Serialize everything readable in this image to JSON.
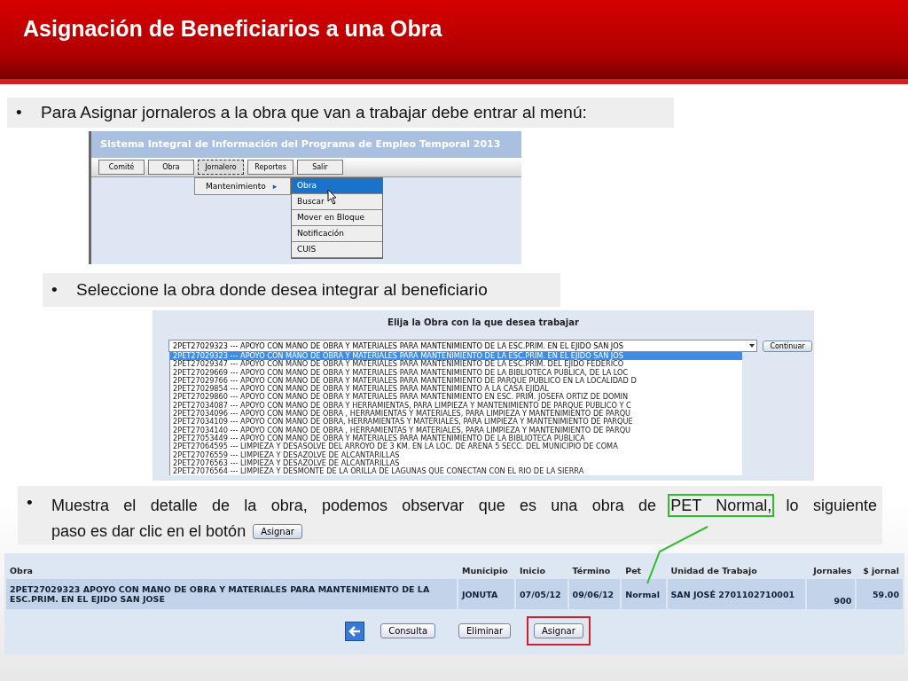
{
  "title": "Asignación de Beneficiarios a una Obra",
  "bullet_1": {
    "marker": "•",
    "text": "Para Asignar jornaleros a la obra que van a trabajar  debe entrar al menú:"
  },
  "menu_screen": {
    "app_title": "Sistema Integral de Información del Programa de Empleo Temporal 2013",
    "menu": [
      {
        "label": "Comité",
        "open": false
      },
      {
        "label": "Obra",
        "open": false
      },
      {
        "label": "Jornalero",
        "open": true
      },
      {
        "label": "Reportes",
        "open": false
      },
      {
        "label": "Salir",
        "open": false
      }
    ],
    "submenu": {
      "label": "Mantenimiento",
      "arrow": "▸"
    },
    "items": [
      {
        "label": "Obra",
        "selected": true
      },
      {
        "label": "Buscar",
        "selected": false
      },
      {
        "label": "Mover en Bloque",
        "selected": false
      },
      {
        "label": "Notificación",
        "selected": false
      },
      {
        "label": "CUIS",
        "selected": false
      }
    ]
  },
  "bullet_2": {
    "marker": "•",
    "text": "Seleccione la obra donde desea integrar al beneficiario"
  },
  "select_screen": {
    "heading": "Elija la Obra con la que desea trabajar",
    "value": "2PET27029323 --- APOYO CON MANO DE OBRA Y MATERIALES PARA MANTENIMIENTO DE LA ESC.PRIM. EN EL EJIDO SAN JOS",
    "button": "Continuar",
    "options": [
      {
        "text": "2PET27029323 --- APOYO CON MANO DE OBRA Y MATERIALES PARA MANTENIMIENTO DE LA ESC.PRIM. EN EL EJIDO SAN JOS",
        "selected": true
      },
      {
        "text": "2PET27029347 --- APOYO CON MANO DE OBRA Y MATERIALES PARA MANTENIMIENTO DE LA ESC.PRIM. DEL EJIDO FEDERICO",
        "selected": false
      },
      {
        "text": "2PET27029669 --- APOYO CON MANO DE OBRA Y MATERIALES PARA MANTENIMIENTO DE LA BIBLIOTECA PUBLICA, DE LA LOC",
        "selected": false
      },
      {
        "text": "2PET27029766 --- APOYO CON MANO DE OBRA Y MATERIALES PARA MANTENIMIENTO DE PARQUE PUBLICO EN LA LOCALIDAD D",
        "selected": false
      },
      {
        "text": "2PET27029854 --- APOYO CON MANO DE OBRA Y MATERIALES PARA MANTENIMIENTO A LA CASA EJIDAL",
        "selected": false
      },
      {
        "text": "2PET27029860 --- APOYO CON MANO DE OBRA Y MATERIALES PARA MANTENIMIENTO EN ESC. PRIM. JOSEFA ORTIZ DE DOMIN",
        "selected": false
      },
      {
        "text": "2PET27034087 --- APOYO CON MANO DE OBRA Y HERRAMIENTAS, PARA LIMPIEZA Y MANTENIMIENTO DE PARQUE PUBLICO Y C",
        "selected": false
      },
      {
        "text": "2PET27034096 --- APOYO CON MANO DE OBRA , HERRAMIENTAS Y MATERIALES, PARA LIMPIEZA Y MANTENIMIENTO DE PARQU",
        "selected": false
      },
      {
        "text": "2PET27034109 --- APOYO CON MANO DE OBRA, HERRAMIENTAS Y MATERIALES, PARA LIMPIEZA Y MANTENIMIENTO DE PARQUE",
        "selected": false
      },
      {
        "text": "2PET27034140 --- APOYO CON MANO DE OBRA , HERRAMIENTAS Y MATERIALES, PARA LIMPIEZA Y MANTENIMIENTO DE PARQU",
        "selected": false
      },
      {
        "text": "2PET27053449 --- APOYO CON MANO DE OBRA Y MATERIALES PARA MANTENIMIENTO DE LA BIBLIOTECA PUBLICA",
        "selected": false
      },
      {
        "text": "2PET27064595 --- LIMPIEZA Y DESASOLVE DEL ARROYO DE 3 KM. EN LA LOC. DE ARENA 5 SECC. DEL MUNICIPIO DE COMA",
        "selected": false
      },
      {
        "text": "2PET27076559 --- LIMPIEZA Y DESAZOLVE DE ALCANTARILLAS",
        "selected": false
      },
      {
        "text": "2PET27076563 --- LIMPIEZA Y DESAZOLVE DE ALCANTARILLAS",
        "selected": false
      },
      {
        "text": "2PET27076564 --- LIMPIEZA Y DESMONTE DE LA ORILLA DE LAGUNAS QUE CONECTAN CON EL RIO DE LA SIERRA",
        "selected": false
      }
    ]
  },
  "bullet_3": {
    "marker": "•",
    "before": "Muestra el detalle de la obra, podemos observar que es una obra de ",
    "highlight": "PET Normal,",
    "after": " lo siguiente",
    "line_2": "paso es dar clic en el botón",
    "button": "Asignar"
  },
  "detail_table": {
    "columns": [
      "Obra",
      "Municipio",
      "Inicio",
      "Término",
      "Pet",
      "Unidad de Trabajo",
      "Jornales",
      "$ jornal"
    ],
    "row": [
      "2PET27029323   APOYO CON MANO DE OBRA Y MATERIALES PARA MANTENIMIENTO DE LA ESC.PRIM. EN EL EJIDO SAN JOSE",
      "JONUTA",
      "07/05/12",
      "09/06/12",
      "Normal",
      "SAN JOSÉ 2701102710001",
      "900",
      "59.00"
    ],
    "buttons": [
      {
        "label": "Consulta",
        "highlighted": false
      },
      {
        "label": "Eliminar",
        "highlighted": false
      },
      {
        "label": "Asignar",
        "highlighted": true
      }
    ]
  }
}
